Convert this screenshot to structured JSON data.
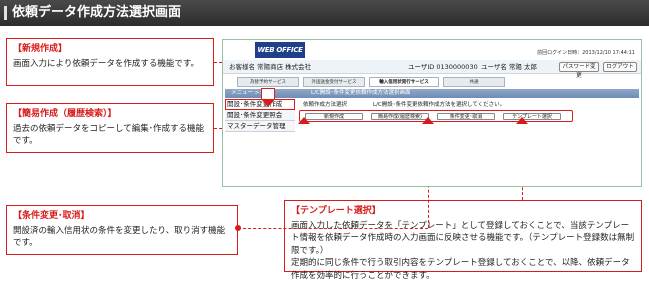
{
  "title": "依頼データ作成方法選択画面",
  "callouts": {
    "new": {
      "heading": "【新規作成】",
      "body": "画面入力により依頼データを作成する機能です。"
    },
    "simple": {
      "heading": "【簡易作成（履歴検索）】",
      "body": "過去の依頼データをコピーして編集･作成する機能です。"
    },
    "change": {
      "heading": "【条件変更･取消】",
      "body": "開設済の輸入信用状の条件を変更したり、取り消す機能です。"
    },
    "template": {
      "heading": "【テンプレート選択】",
      "body1": "画面入力した依頼データを「テンプレート」として登録しておくことで、当該テンプレート情報を依頼データ作成時の入力画面に反映させる機能です。（テンプレート登録数は無制限です。）",
      "body2": "定期的に同じ条件で行う取引内容をテンプレート登録しておくことで、以降、依頼データ作成を効率的に行うことができます。"
    }
  },
  "screen": {
    "logo": "WEB OFFICE",
    "login_time": "前回ログイン日時：2013/12/10 17:44:11",
    "company": "お客様名  常陽商店 株式会社",
    "user_id": "ユーザID  0130000030",
    "user_name": "ユーザ名  常陽 太郎",
    "btn_password": "パスワード変更",
    "btn_logout": "ログアウト",
    "tabs": [
      "為替予約サービス",
      "外国送金受付サービス",
      "輸入信用状発行サービス",
      "共通"
    ],
    "menu_label": "メニュー  >>>",
    "breadcrumb": "L/C開設･条件変更依頼作成方法選択画面",
    "sidebar": [
      "開設･条件変更作成",
      "開設･条件変更照会",
      "マスターデータ管理"
    ],
    "content_label": "依頼作成方法選択",
    "content_text": "L/C開設･条件変更依頼作成方法を選択してください。",
    "buttons": [
      "新規作成",
      "簡易作成(履歴検索)",
      "条件変更･取消",
      "テンプレート選択"
    ]
  }
}
